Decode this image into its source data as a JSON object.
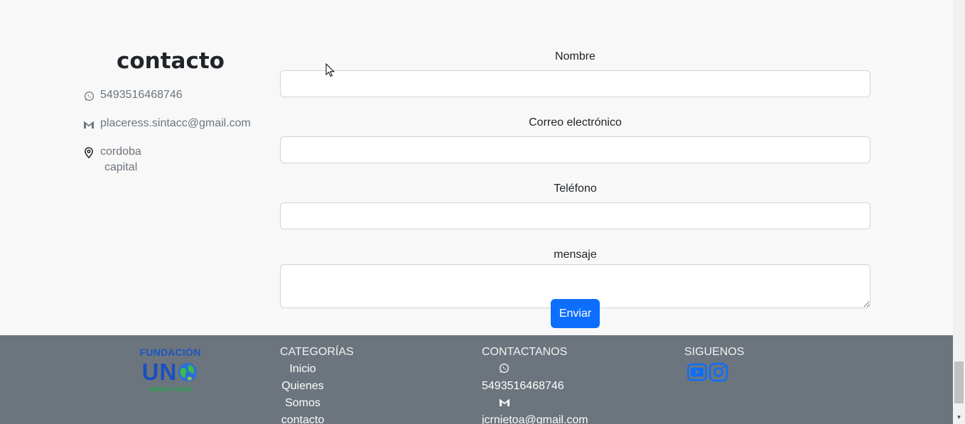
{
  "contact": {
    "title": "contacto",
    "phone": "5493516468746",
    "email": "placeress.sintacc@gmail.com",
    "city_line1": "cordoba",
    "city_line2": "capital"
  },
  "form": {
    "name_label": "Nombre",
    "email_label": "Correo electrónico",
    "phone_label": "Teléfono",
    "message_label": "mensaje",
    "name_value": "",
    "email_value": "",
    "phone_value": "",
    "message_value": "",
    "submit_label": "Enviar"
  },
  "footer": {
    "logo_top": "FUNDACIÓN",
    "logo_main": "UN",
    "logo_bottom": "SOMOS TODOS",
    "categories_title": "CATEGORÍAS",
    "categories": [
      "Inicio",
      "Quienes",
      "Somos",
      "contacto"
    ],
    "contact_title": "CONTACTANOS",
    "contact_phone": "5493516468746",
    "contact_email": "jcrnietoa@gmail.com",
    "follow_title": "SIGUENOS"
  },
  "colors": {
    "accent": "#0d6efd",
    "footer_bg": "#6c757d",
    "page_bg": "#f8f8f8",
    "logo_blue": "#1a56c2",
    "logo_green": "#1fa84a"
  },
  "icons": [
    "whatsapp-icon",
    "gmail-icon",
    "location-pin-icon",
    "youtube-icon",
    "instagram-icon"
  ]
}
